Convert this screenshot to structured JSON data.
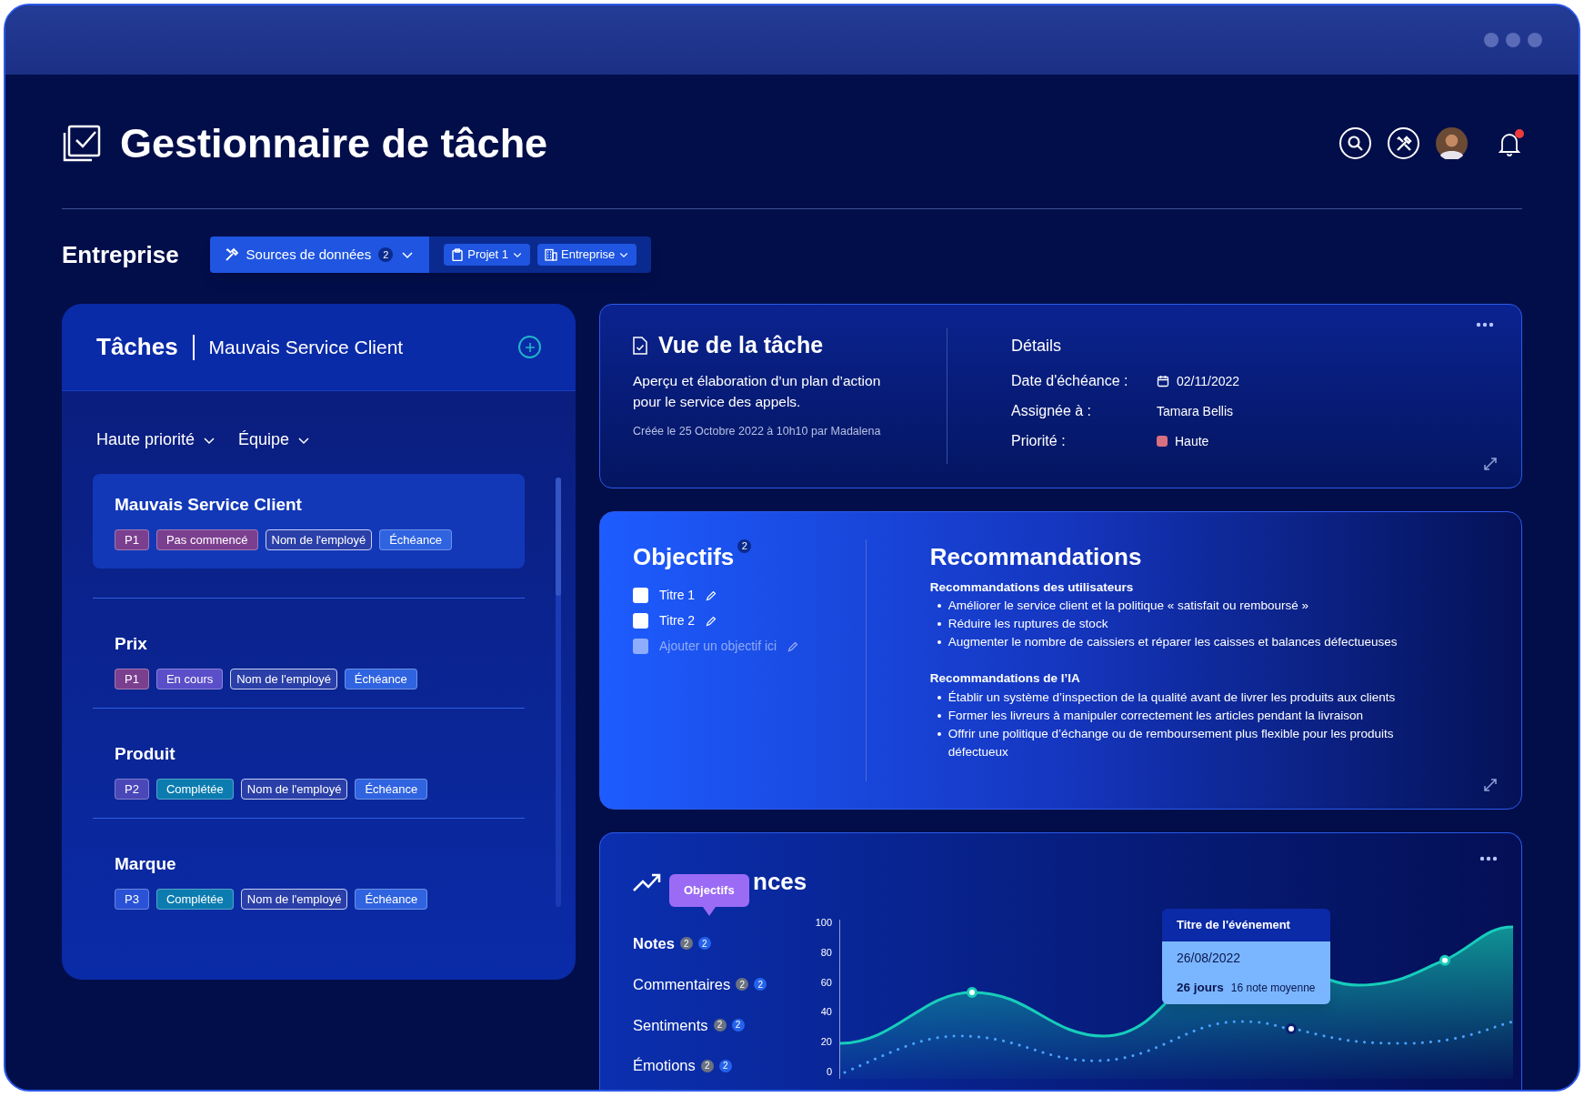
{
  "header": {
    "title": "Gestionnaire de tâche",
    "notification": true
  },
  "toolbar": {
    "label": "Entreprise",
    "filters": [
      {
        "kind": "primary",
        "label": "Sources de données",
        "count": "2"
      },
      {
        "kind": "project",
        "label": "Projet 1"
      },
      {
        "kind": "company",
        "label": "Entreprise"
      }
    ]
  },
  "tasks_panel": {
    "title": "Tâches",
    "subtitle": "Mauvais Service Client",
    "filters": [
      "Haute priorité",
      "Équipe"
    ],
    "tasks": [
      {
        "title": "Mauvais Service Client",
        "selected": true,
        "tags": [
          {
            "kind": "filled",
            "label": "P1",
            "color": "#7b3f8f"
          },
          {
            "kind": "filled",
            "label": "Pas commencé",
            "color": "#7b3f8f"
          },
          {
            "kind": "outline",
            "label": "Nom de l'employé"
          },
          {
            "kind": "filled",
            "label": "Échéance",
            "color": "#2f63e0"
          }
        ]
      },
      {
        "title": "Prix",
        "selected": false,
        "tags": [
          {
            "kind": "filled",
            "label": "P1",
            "color": "#7b3f8f"
          },
          {
            "kind": "filled",
            "label": "En cours",
            "color": "#5a4fc9"
          },
          {
            "kind": "outline",
            "label": "Nom de l'employé"
          },
          {
            "kind": "filled",
            "label": "Échéance",
            "color": "#2f63e0"
          }
        ]
      },
      {
        "title": "Produit",
        "selected": false,
        "tags": [
          {
            "kind": "filled",
            "label": "P2",
            "color": "#4a47b8"
          },
          {
            "kind": "filled",
            "label": "Complétée",
            "color": "#0c7cb0"
          },
          {
            "kind": "outline",
            "label": "Nom de l'employé"
          },
          {
            "kind": "filled",
            "label": "Échéance",
            "color": "#2f63e0"
          }
        ]
      },
      {
        "title": "Marque",
        "selected": false,
        "tags": [
          {
            "kind": "filled",
            "label": "P3",
            "color": "#2a52d6"
          },
          {
            "kind": "filled",
            "label": "Complétée",
            "color": "#0c7cb0"
          },
          {
            "kind": "outline",
            "label": "Nom de l'employé"
          },
          {
            "kind": "filled",
            "label": "Échéance",
            "color": "#2f63e0"
          }
        ]
      }
    ]
  },
  "task_view": {
    "title": "Vue de la tâche",
    "description": "Aperçu et élaboration d’un plan d’action pour le service des appels.",
    "created": "Créée le 25 Octobre 2022 à 10h10 par Madalena",
    "details_title": "Détails",
    "details": [
      {
        "kind": "date",
        "label": "Date d'échéance :",
        "value": "02/11/2022"
      },
      {
        "kind": "text",
        "label": "Assignée à :",
        "value": "Tamara Bellis"
      },
      {
        "kind": "priority",
        "label": "Priorité :",
        "value": "Haute",
        "color": "#d9707f"
      }
    ]
  },
  "objectives": {
    "title": "Objectifs",
    "count": "2",
    "items": [
      {
        "kind": "item",
        "label": "Titre 1",
        "checked": false
      },
      {
        "kind": "item",
        "label": "Titre 2",
        "checked": false
      },
      {
        "kind": "add",
        "label": "Ajouter un objectif ici",
        "checked": false
      }
    ]
  },
  "recommendations": {
    "title": "Recommandations",
    "groups": [
      {
        "heading": "Recommandations des utilisateurs",
        "items": [
          "Améliorer le service client et la politique « satisfait ou remboursé »",
          "Réduire les ruptures de stock",
          "Augmenter le nombre de caissiers et réparer les caisses et balances défectueuses"
        ]
      },
      {
        "heading": "Recommandations de l’IA",
        "items": [
          "Établir un système d’inspection de la qualité avant de livrer les produits aux clients",
          "Former les livreurs à manipuler correctement les articles pendant la livraison",
          "Offrir une politique d’échange ou de remboursement plus flexible pour les produits défectueux"
        ]
      }
    ]
  },
  "trends": {
    "title": "nces",
    "tooltip": "Objectifs",
    "metrics": [
      {
        "label": "Notes",
        "selected": true,
        "counts": [
          "2",
          "2"
        ]
      },
      {
        "label": "Commentaires",
        "selected": false,
        "counts": [
          "2",
          "2"
        ]
      },
      {
        "label": "Sentiments",
        "selected": false,
        "counts": [
          "2",
          "2"
        ]
      },
      {
        "label": "Émotions",
        "selected": false,
        "counts": [
          "2",
          "2"
        ]
      }
    ],
    "y_axis": [
      "100",
      "80",
      "60",
      "40",
      "20",
      "0"
    ],
    "event": {
      "title": "Titre de l'événement",
      "date": "26/08/2022",
      "duration": "26 jours",
      "note": "16 note moyenne"
    }
  }
}
